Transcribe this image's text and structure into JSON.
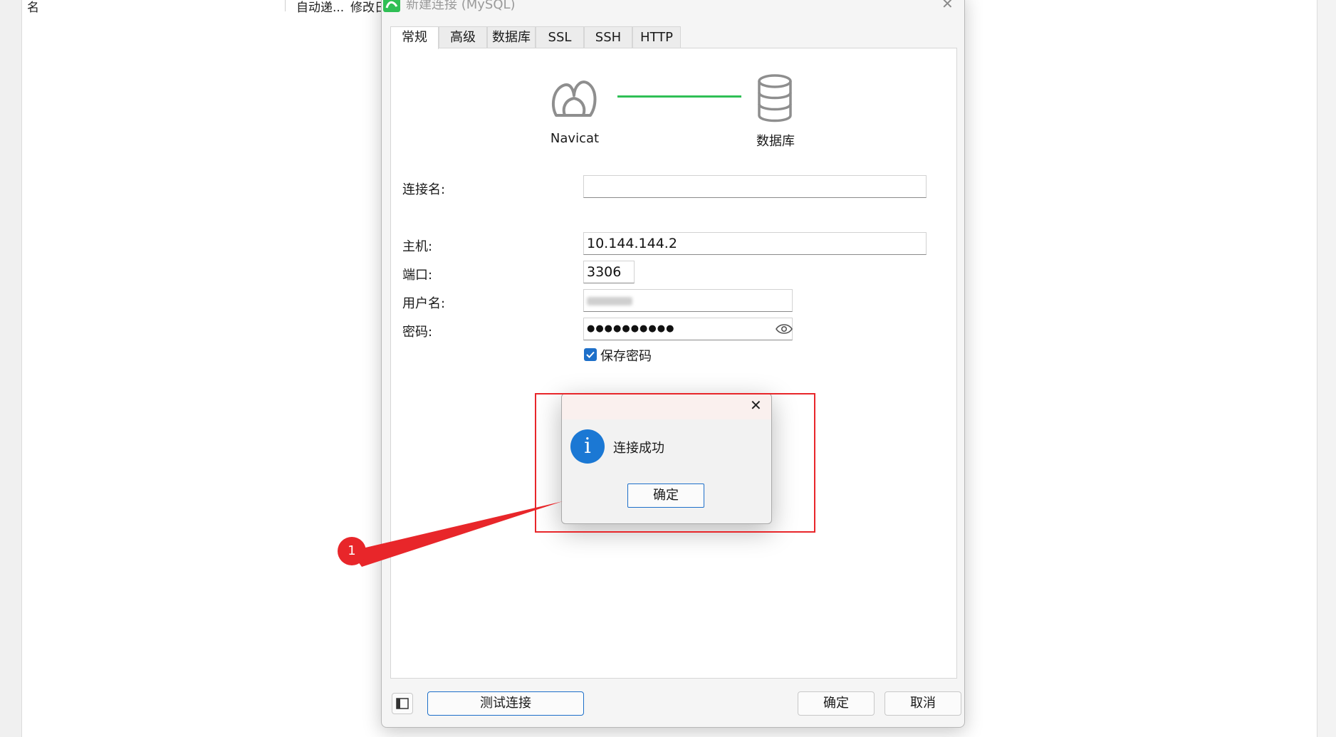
{
  "background": {
    "left_col_text": "名",
    "col1_text": "自动递...",
    "col2_text": "修改日"
  },
  "dialog": {
    "title": "新建连接 (MySQL)",
    "close_glyph": "✕",
    "tabs": [
      "常规",
      "高级",
      "数据库",
      "SSL",
      "SSH",
      "HTTP"
    ],
    "diagram": {
      "left_label": "Navicat",
      "right_label": "数据库"
    },
    "form": {
      "connection_name_label": "连接名:",
      "connection_name_value": "",
      "host_label": "主机:",
      "host_value": "10.144.144.2",
      "port_label": "端口:",
      "port_value": "3306",
      "username_label": "用户名:",
      "username_value": "",
      "password_label": "密码:",
      "password_value": "●●●●●●●●●●",
      "save_password_label": "保存密码",
      "save_password_checked": true
    },
    "buttons": {
      "test_connection": "测试连接",
      "ok": "确定",
      "cancel": "取消"
    }
  },
  "message_box": {
    "text": "连接成功",
    "icon_glyph": "i",
    "ok": "确定",
    "close_glyph": "✕"
  },
  "annotation": {
    "number": "1"
  },
  "colors": {
    "accent": "#1d6fc9",
    "annotation_red": "#e8262a",
    "connection_line": "#2fbf55"
  }
}
